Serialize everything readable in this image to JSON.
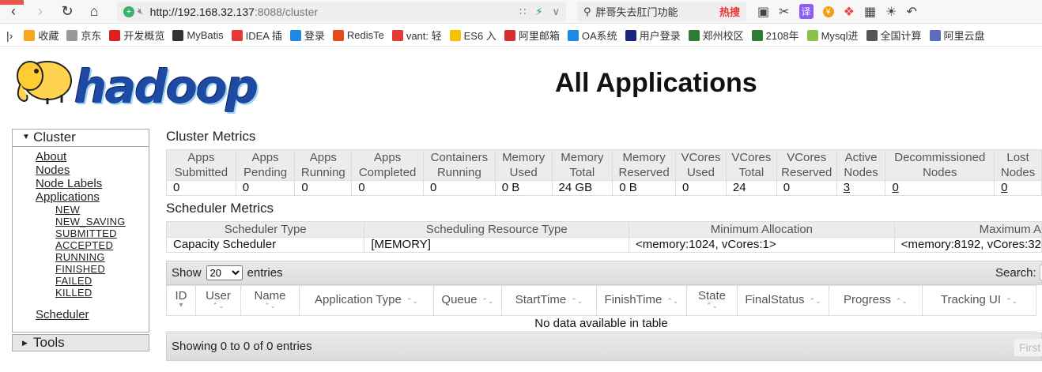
{
  "browser": {
    "url_host": "http://192.168.32.137",
    "url_path": ":8088/cluster",
    "search_text": "胖哥失去肛门功能",
    "search_hot": "热搜",
    "translate_label": "译"
  },
  "bookmarks": [
    {
      "label": "收藏",
      "icon": "star-icon",
      "color": "#f5a623"
    },
    {
      "label": "京东",
      "icon": "page-icon",
      "color": "#999999"
    },
    {
      "label": "开发概览",
      "icon": "huawei-icon",
      "color": "#e02020"
    },
    {
      "label": "MyBatis",
      "icon": "mybatis-icon",
      "color": "#333333"
    },
    {
      "label": "IDEA 插",
      "icon": "g-icon",
      "color": "#e53935"
    },
    {
      "label": "登录",
      "icon": "globe-icon",
      "color": "#1e88e5"
    },
    {
      "label": "RedisTe",
      "icon": "c-icon",
      "color": "#e64a19"
    },
    {
      "label": "vant: 轻",
      "icon": "g-icon",
      "color": "#e53935"
    },
    {
      "label": "ES6 入",
      "icon": "es-icon",
      "color": "#f2c200"
    },
    {
      "label": "阿里邮箱",
      "icon": "m-icon",
      "color": "#d32f2f"
    },
    {
      "label": "OA系统",
      "icon": "c-icon",
      "color": "#1e88e5"
    },
    {
      "label": "用户登录",
      "icon": "p-icon",
      "color": "#1a237e"
    },
    {
      "label": "郑州校区",
      "icon": "sheet-icon",
      "color": "#2e7d32"
    },
    {
      "label": "2108年",
      "icon": "sheet-icon",
      "color": "#2e7d32"
    },
    {
      "label": "Mysql进",
      "icon": "mysql-icon",
      "color": "#8bc34a"
    },
    {
      "label": "全国计算",
      "icon": "eye-icon",
      "color": "#555555"
    },
    {
      "label": "阿里云盘",
      "icon": "cloud-icon",
      "color": "#5c6bc0"
    }
  ],
  "header": {
    "logo_text": "hadoop",
    "title": "All Applications"
  },
  "nav": {
    "cluster_label": "Cluster",
    "links": [
      "About",
      "Nodes",
      "Node Labels",
      "Applications"
    ],
    "app_states": [
      "NEW",
      "NEW_SAVING",
      "SUBMITTED",
      "ACCEPTED",
      "RUNNING",
      "FINISHED",
      "FAILED",
      "KILLED"
    ],
    "scheduler_label": "Scheduler",
    "tools_label": "Tools"
  },
  "cluster_metrics": {
    "title": "Cluster Metrics",
    "headers": [
      [
        "Apps",
        "Submitted"
      ],
      [
        "Apps",
        "Pending"
      ],
      [
        "Apps",
        "Running"
      ],
      [
        "Apps",
        "Completed"
      ],
      [
        "Containers",
        "Running"
      ],
      [
        "Memory",
        "Used"
      ],
      [
        "Memory",
        "Total"
      ],
      [
        "Memory",
        "Reserved"
      ],
      [
        "VCores",
        "Used"
      ],
      [
        "VCores",
        "Total"
      ],
      [
        "VCores",
        "Reserved"
      ],
      [
        "Active",
        "Nodes"
      ],
      [
        "Decommissioned",
        "Nodes"
      ],
      [
        "Lost",
        "Nodes"
      ]
    ],
    "values": [
      "0",
      "0",
      "0",
      "0",
      "0",
      "0 B",
      "24 GB",
      "0 B",
      "0",
      "24",
      "0",
      "3",
      "0",
      "0"
    ]
  },
  "scheduler_metrics": {
    "title": "Scheduler Metrics",
    "headers": [
      "Scheduler Type",
      "Scheduling Resource Type",
      "Minimum Allocation",
      "Maximum A"
    ],
    "values": [
      "Capacity Scheduler",
      "[MEMORY]",
      "<memory:1024, vCores:1>",
      "<memory:8192, vCores:32"
    ]
  },
  "apps_table": {
    "show_label": "Show",
    "page_size": "20",
    "entries_label": "entries",
    "search_label": "Search:",
    "columns": [
      [
        "ID",
        ""
      ],
      [
        "User",
        ""
      ],
      [
        "Name",
        ""
      ],
      [
        "Application Type",
        ""
      ],
      [
        "Queue",
        ""
      ],
      [
        "StartTime",
        ""
      ],
      [
        "FinishTime",
        ""
      ],
      [
        "State",
        ""
      ],
      [
        "FinalStatus",
        ""
      ],
      [
        "Progress",
        ""
      ],
      [
        "Tracking UI",
        ""
      ]
    ],
    "empty_text": "No data available in table",
    "info_text": "Showing 0 to 0 of 0 entries",
    "first_label": "First"
  }
}
